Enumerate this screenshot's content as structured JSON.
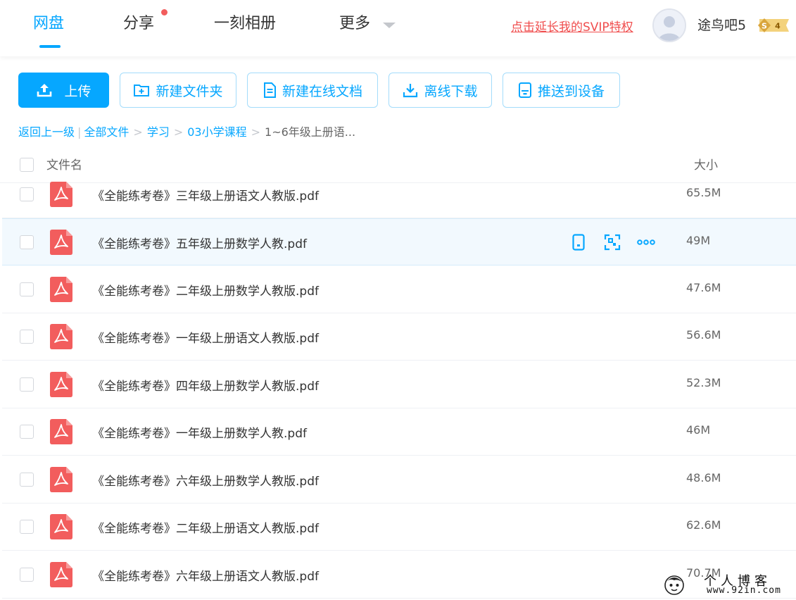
{
  "nav": {
    "tabs": [
      {
        "label": "网盘",
        "active": true
      },
      {
        "label": "分享",
        "has_dot": true
      },
      {
        "label": "一刻相册"
      },
      {
        "label": "更多"
      }
    ],
    "svip_link": "点击延长我的SVIP特权",
    "username": "途鸟吧5",
    "badge": {
      "s": "S",
      "level": "4"
    }
  },
  "toolbar": {
    "upload": "上传",
    "new_folder": "新建文件夹",
    "new_doc": "新建在线文档",
    "offline_download": "离线下载",
    "push_device": "推送到设备"
  },
  "breadcrumb": {
    "back": "返回上一级",
    "items": [
      "全部文件",
      "学习",
      "03小学课程"
    ],
    "current": "1~6年级上册语..."
  },
  "list": {
    "col_name": "文件名",
    "col_size": "大小",
    "files": [
      {
        "name": "《全能练考卷》三年级上册语文人教版.pdf",
        "size": "65.5M"
      },
      {
        "name": "《全能练考卷》五年级上册数学人教.pdf",
        "size": "49M",
        "hover": true
      },
      {
        "name": "《全能练考卷》二年级上册数学人教版.pdf",
        "size": "47.6M"
      },
      {
        "name": "《全能练考卷》一年级上册语文人教版.pdf",
        "size": "56.6M"
      },
      {
        "name": "《全能练考卷》四年级上册数学人教版.pdf",
        "size": "52.3M"
      },
      {
        "name": "《全能练考卷》一年级上册数学人教.pdf",
        "size": "46M"
      },
      {
        "name": "《全能练考卷》六年级上册数学人教版.pdf",
        "size": "48.6M"
      },
      {
        "name": "《全能练考卷》二年级上册语文人教版.pdf",
        "size": "62.6M"
      },
      {
        "name": "《全能练考卷》六年级上册语文人教版.pdf",
        "size": "70.7M"
      }
    ]
  },
  "row_actions": [
    "phone-push-icon",
    "scan-icon",
    "more-icon"
  ],
  "watermark": {
    "title": "个人博客",
    "url": "www.92in.com"
  },
  "colors": {
    "accent": "#06a7ff",
    "alert": "#f04d4d",
    "pdf": "#f25d5d"
  }
}
